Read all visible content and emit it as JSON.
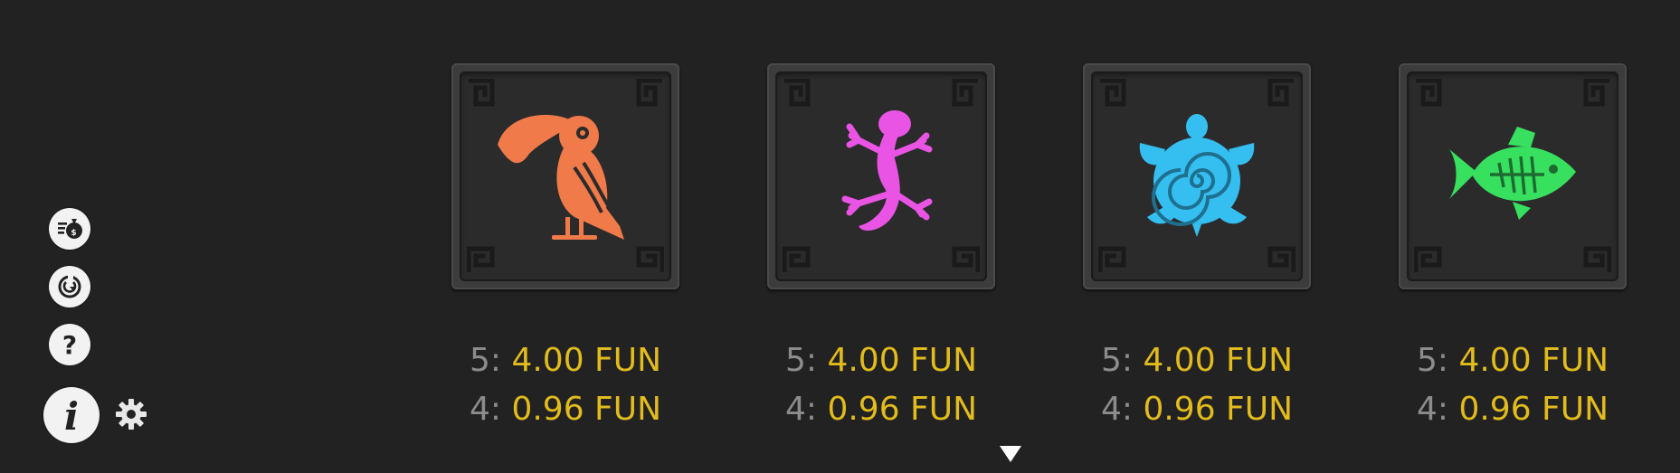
{
  "sidebar": {
    "history_icon": "bet-history-icon",
    "autoplay_icon": "autoplay-icon",
    "help_icon": "help-icon",
    "info_icon": "info-icon",
    "settings_icon": "gear-icon"
  },
  "paytable": {
    "symbols": [
      {
        "icon": "toucan-icon",
        "color": "#f07a4a",
        "lines": [
          {
            "count": "5:",
            "amount": "4.00 FUN"
          },
          {
            "count": "4:",
            "amount": "0.96 FUN"
          }
        ]
      },
      {
        "icon": "gecko-icon",
        "color": "#ea54e4",
        "lines": [
          {
            "count": "5:",
            "amount": "4.00 FUN"
          },
          {
            "count": "4:",
            "amount": "0.96 FUN"
          }
        ]
      },
      {
        "icon": "turtle-icon",
        "color": "#35bff0",
        "lines": [
          {
            "count": "5:",
            "amount": "4.00 FUN"
          },
          {
            "count": "4:",
            "amount": "0.96 FUN"
          }
        ]
      },
      {
        "icon": "fish-icon",
        "color": "#38e060",
        "lines": [
          {
            "count": "5:",
            "amount": "4.00 FUN"
          },
          {
            "count": "4:",
            "amount": "0.96 FUN"
          }
        ]
      }
    ]
  },
  "scroll": {
    "icon": "scroll-down-arrow-icon"
  },
  "colors": {
    "background": "#222222",
    "amount": "#e2bb1d",
    "count": "#8c8c8c"
  }
}
